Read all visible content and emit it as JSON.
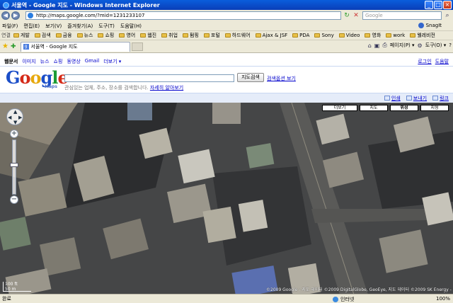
{
  "window": {
    "title": "서울역 - Google 지도 - Windows Internet Explorer",
    "buttons": [
      "_",
      "□",
      "×"
    ]
  },
  "address": {
    "url": "http://maps.google.com/?mid=1231233107",
    "search_placeholder": "Google"
  },
  "menu": {
    "items": [
      "파일(F)",
      "편집(E)",
      "보기(V)",
      "즐겨찾기(A)",
      "도구(T)",
      "도움말(H)"
    ],
    "snagit_label": "SnagIt"
  },
  "links": {
    "label": "연결",
    "items": [
      "게발",
      "검색",
      "금융",
      "뉴스",
      "쇼핑",
      "영어",
      "웹진",
      "취업",
      "펌핑",
      "포털",
      "하드웨어",
      "Ajax & JSF",
      "PDA",
      "Sony",
      "Video",
      "영화",
      "work",
      "웰레비전"
    ]
  },
  "tabs": {
    "active_title": "서울역 - Google 지도",
    "commands": {
      "page": "페이지(P) ▾",
      "tools": "도구(O) ▾",
      "help": "?"
    }
  },
  "google": {
    "top_links": [
      "웹문서",
      "이미지",
      "뉴스",
      "쇼핑",
      "동영상",
      "Gmail",
      "더보기 ▾"
    ],
    "active_link_index": 0,
    "signin_links": [
      "로그인",
      "도움말"
    ],
    "logo_sub": "Maps",
    "search_value": "",
    "search_button": "지도검색",
    "search_options": "검색옵션 보기",
    "search_hint": "관심있는 업체, 주소, 장소를 검색합니다.",
    "search_hint_link": "자세히 알아보기"
  },
  "map_toolbar": {
    "print": "인쇄",
    "send": "보내기",
    "link": "링크"
  },
  "map": {
    "types": [
      "더보기",
      "지도",
      "위성",
      "지형"
    ],
    "selected_type_index": 2,
    "scale_metric": "50 m",
    "scale_imperial": "100 ft",
    "copyright": "©2009 Google - 지도 데이터 ©2009 DigitalGlobe, GeoEye, 지도 데이터 ©2009 SK Energy - 이용약관"
  },
  "status": {
    "left": "완료",
    "zone": "인터넷",
    "zoom": "100%"
  },
  "colors": {
    "titlebar": "#0a3fb8",
    "link": "#0000cc",
    "mapbar": "#e5ecf9",
    "satellite_base": "#4a4b4c"
  }
}
